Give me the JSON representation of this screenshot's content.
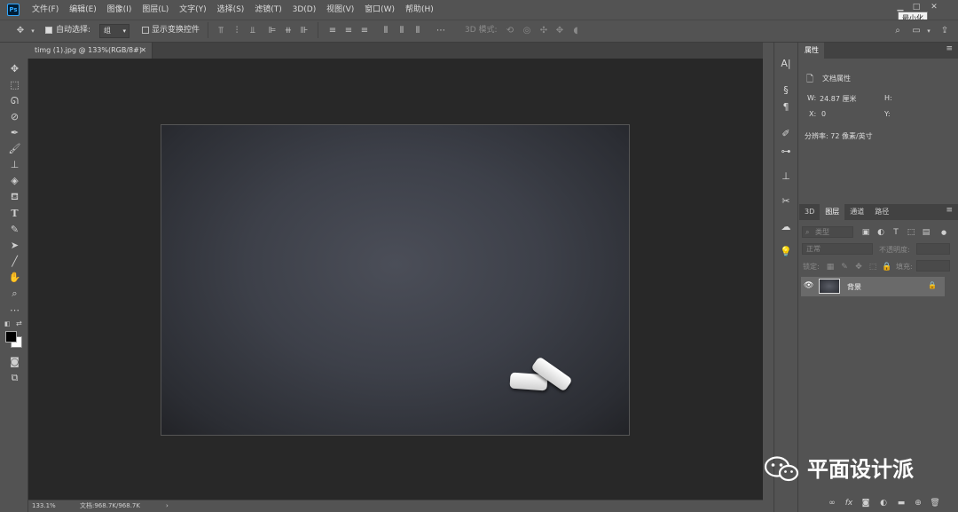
{
  "app": {
    "logo_text": "Ps"
  },
  "menu": [
    "文件(F)",
    "编辑(E)",
    "图像(I)",
    "图层(L)",
    "文字(Y)",
    "选择(S)",
    "滤镜(T)",
    "3D(D)",
    "视图(V)",
    "窗口(W)",
    "帮助(H)"
  ],
  "window_controls": {
    "minimize_tooltip": "最小化"
  },
  "options_bar": {
    "auto_select_label": "自动选择:",
    "auto_select_checked": true,
    "layer_select_value": "组",
    "show_transform_label": "显示变换控件",
    "show_transform_checked": false,
    "mode_3d_label": "3D 模式:"
  },
  "document": {
    "tab_title": "timg (1).jpg @ 133%(RGB/8#)",
    "zoom": "133.1%",
    "doc_size": "文档:968.7K/968.7K"
  },
  "properties_panel": {
    "tab": "属性",
    "section_title": "文档属性",
    "w_label": "W:",
    "w_value": "24.87 厘米",
    "h_label": "H:",
    "x_label": "X:",
    "x_value": "0",
    "y_label": "Y:",
    "resolution": "分辨率: 72 像素/英寸"
  },
  "layers_panel": {
    "tabs": [
      "3D",
      "图层",
      "通道",
      "路径"
    ],
    "active_tab": "图层",
    "filter_placeholder": "类型",
    "blend_mode": "正常",
    "opacity_label": "不透明度:",
    "lock_label": "锁定:",
    "fill_label": "填充:",
    "layers": [
      {
        "name": "背景",
        "visible": true,
        "locked": true
      }
    ]
  },
  "watermark": {
    "text": "平面设计派"
  },
  "colors": {
    "ui_bg": "#535353",
    "canvas_bg": "#282828",
    "accent": "#31a8ff"
  }
}
